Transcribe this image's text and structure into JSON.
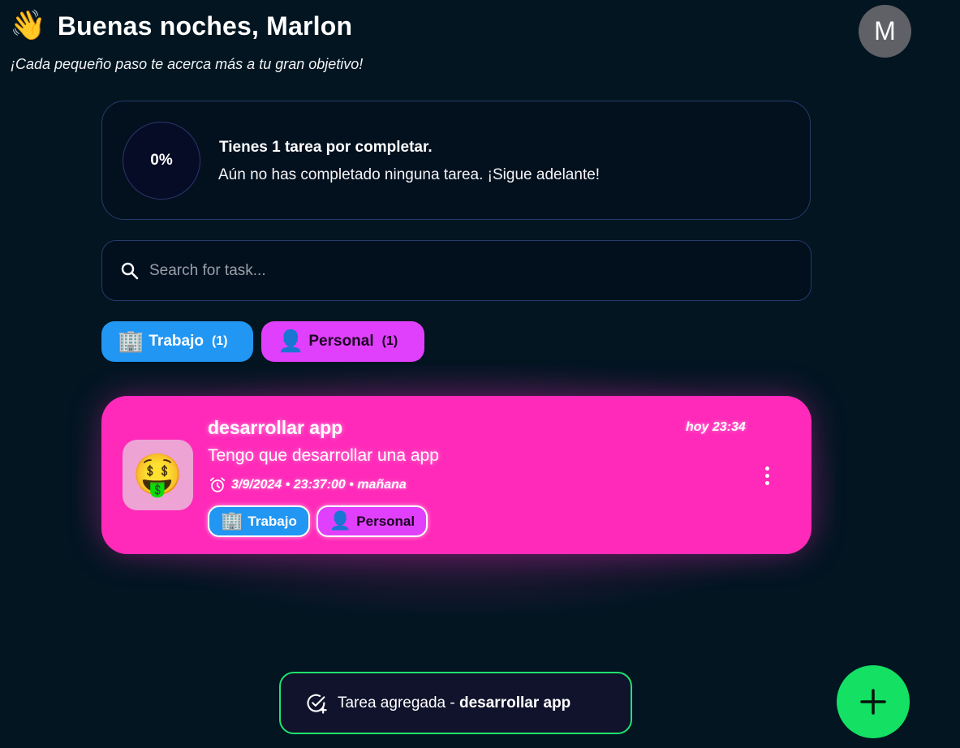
{
  "header": {
    "wave_emoji": "👋",
    "greeting": "Buenas noches, Marlon",
    "subtitle": "¡Cada pequeño paso te acerca más a tu gran objetivo!",
    "avatar_initial": "M",
    "avatar_color": "#5f6166"
  },
  "progress": {
    "percent_label": "0%",
    "percent": 0,
    "title": "Tienes 1 tarea por completar.",
    "message": "Aún no has completado ninguna tarea. ¡Sigue adelante!"
  },
  "search": {
    "placeholder": "Search for task...",
    "value": "",
    "icon": "search-icon"
  },
  "categories": [
    {
      "emoji": "🏢",
      "label": "Trabajo",
      "count": "(1)",
      "color": "#2196f3"
    },
    {
      "emoji": "👤",
      "label": "Personal",
      "count": "(1)",
      "color": "#e040fb"
    }
  ],
  "task": {
    "emoji": "🤑",
    "title": "desarrollar app",
    "time": "hoy 23:34",
    "description": "Tengo que desarrollar una app",
    "due": "3/9/2024 • 23:37:00 • mañana",
    "color": "#ff2ab9",
    "tags": [
      {
        "emoji": "🏢",
        "label": "Trabajo"
      },
      {
        "emoji": "👤",
        "label": "Personal"
      }
    ]
  },
  "toast": {
    "prefix": "Tarea agregada - ",
    "task_name": "desarrollar app",
    "border_color": "#1fe36b"
  },
  "fab": {
    "icon": "plus-icon",
    "color": "#14e063"
  }
}
